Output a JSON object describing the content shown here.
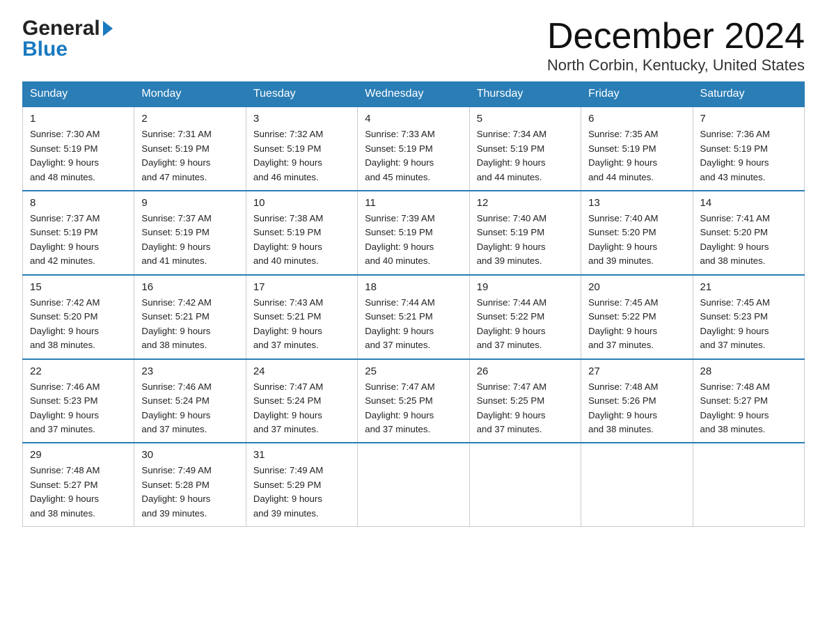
{
  "header": {
    "logo_general": "General",
    "logo_blue": "Blue",
    "month_title": "December 2024",
    "location": "North Corbin, Kentucky, United States"
  },
  "weekdays": [
    "Sunday",
    "Monday",
    "Tuesday",
    "Wednesday",
    "Thursday",
    "Friday",
    "Saturday"
  ],
  "weeks": [
    [
      {
        "day": "1",
        "sunrise": "7:30 AM",
        "sunset": "5:19 PM",
        "daylight": "9 hours and 48 minutes."
      },
      {
        "day": "2",
        "sunrise": "7:31 AM",
        "sunset": "5:19 PM",
        "daylight": "9 hours and 47 minutes."
      },
      {
        "day": "3",
        "sunrise": "7:32 AM",
        "sunset": "5:19 PM",
        "daylight": "9 hours and 46 minutes."
      },
      {
        "day": "4",
        "sunrise": "7:33 AM",
        "sunset": "5:19 PM",
        "daylight": "9 hours and 45 minutes."
      },
      {
        "day": "5",
        "sunrise": "7:34 AM",
        "sunset": "5:19 PM",
        "daylight": "9 hours and 44 minutes."
      },
      {
        "day": "6",
        "sunrise": "7:35 AM",
        "sunset": "5:19 PM",
        "daylight": "9 hours and 44 minutes."
      },
      {
        "day": "7",
        "sunrise": "7:36 AM",
        "sunset": "5:19 PM",
        "daylight": "9 hours and 43 minutes."
      }
    ],
    [
      {
        "day": "8",
        "sunrise": "7:37 AM",
        "sunset": "5:19 PM",
        "daylight": "9 hours and 42 minutes."
      },
      {
        "day": "9",
        "sunrise": "7:37 AM",
        "sunset": "5:19 PM",
        "daylight": "9 hours and 41 minutes."
      },
      {
        "day": "10",
        "sunrise": "7:38 AM",
        "sunset": "5:19 PM",
        "daylight": "9 hours and 40 minutes."
      },
      {
        "day": "11",
        "sunrise": "7:39 AM",
        "sunset": "5:19 PM",
        "daylight": "9 hours and 40 minutes."
      },
      {
        "day": "12",
        "sunrise": "7:40 AM",
        "sunset": "5:19 PM",
        "daylight": "9 hours and 39 minutes."
      },
      {
        "day": "13",
        "sunrise": "7:40 AM",
        "sunset": "5:20 PM",
        "daylight": "9 hours and 39 minutes."
      },
      {
        "day": "14",
        "sunrise": "7:41 AM",
        "sunset": "5:20 PM",
        "daylight": "9 hours and 38 minutes."
      }
    ],
    [
      {
        "day": "15",
        "sunrise": "7:42 AM",
        "sunset": "5:20 PM",
        "daylight": "9 hours and 38 minutes."
      },
      {
        "day": "16",
        "sunrise": "7:42 AM",
        "sunset": "5:21 PM",
        "daylight": "9 hours and 38 minutes."
      },
      {
        "day": "17",
        "sunrise": "7:43 AM",
        "sunset": "5:21 PM",
        "daylight": "9 hours and 37 minutes."
      },
      {
        "day": "18",
        "sunrise": "7:44 AM",
        "sunset": "5:21 PM",
        "daylight": "9 hours and 37 minutes."
      },
      {
        "day": "19",
        "sunrise": "7:44 AM",
        "sunset": "5:22 PM",
        "daylight": "9 hours and 37 minutes."
      },
      {
        "day": "20",
        "sunrise": "7:45 AM",
        "sunset": "5:22 PM",
        "daylight": "9 hours and 37 minutes."
      },
      {
        "day": "21",
        "sunrise": "7:45 AM",
        "sunset": "5:23 PM",
        "daylight": "9 hours and 37 minutes."
      }
    ],
    [
      {
        "day": "22",
        "sunrise": "7:46 AM",
        "sunset": "5:23 PM",
        "daylight": "9 hours and 37 minutes."
      },
      {
        "day": "23",
        "sunrise": "7:46 AM",
        "sunset": "5:24 PM",
        "daylight": "9 hours and 37 minutes."
      },
      {
        "day": "24",
        "sunrise": "7:47 AM",
        "sunset": "5:24 PM",
        "daylight": "9 hours and 37 minutes."
      },
      {
        "day": "25",
        "sunrise": "7:47 AM",
        "sunset": "5:25 PM",
        "daylight": "9 hours and 37 minutes."
      },
      {
        "day": "26",
        "sunrise": "7:47 AM",
        "sunset": "5:25 PM",
        "daylight": "9 hours and 37 minutes."
      },
      {
        "day": "27",
        "sunrise": "7:48 AM",
        "sunset": "5:26 PM",
        "daylight": "9 hours and 38 minutes."
      },
      {
        "day": "28",
        "sunrise": "7:48 AM",
        "sunset": "5:27 PM",
        "daylight": "9 hours and 38 minutes."
      }
    ],
    [
      {
        "day": "29",
        "sunrise": "7:48 AM",
        "sunset": "5:27 PM",
        "daylight": "9 hours and 38 minutes."
      },
      {
        "day": "30",
        "sunrise": "7:49 AM",
        "sunset": "5:28 PM",
        "daylight": "9 hours and 39 minutes."
      },
      {
        "day": "31",
        "sunrise": "7:49 AM",
        "sunset": "5:29 PM",
        "daylight": "9 hours and 39 minutes."
      },
      null,
      null,
      null,
      null
    ]
  ],
  "labels": {
    "sunrise": "Sunrise:",
    "sunset": "Sunset:",
    "daylight": "Daylight:"
  }
}
